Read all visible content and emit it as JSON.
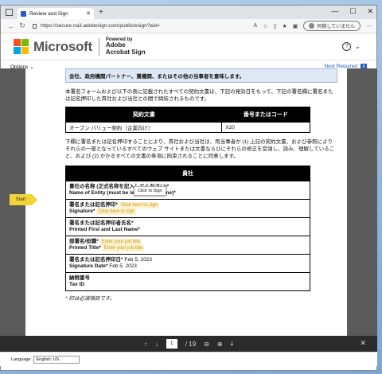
{
  "browser": {
    "tab_title": "Review and Sign",
    "url": "https://secure.na3.adobesign.com/public/esign?aid=",
    "not_synced": "同期していません"
  },
  "brand": {
    "company": "Microsoft",
    "powered_by": "Powered by",
    "product": "Adobe\nAcrobat Sign"
  },
  "toolbar": {
    "options": "Options",
    "next_required": "Next Required",
    "next_count": "8"
  },
  "document": {
    "highlight_text": "会社、政府機関パートナー、賃機関、またはその他の当事者を意味します。",
    "intro": "本署名フォームおよび以下の表に記載されたすべての契約文書は、下記の発効日をもって、下記の署名欄に署名または記名押印した貴社および当社との間で締結されるものです。",
    "contract_table": {
      "headers": [
        "契約文書",
        "番号またはコード"
      ],
      "rows": [
        [
          "オープン バリュー契約（企業向け）",
          "X20"
        ]
      ]
    },
    "agreement_para": "下欄に署名または記名押印することにより、貴社および当社は、両当事者が (1) 上記の契約文書、および参照によりそれらの一部となっているすべてのウェブ サイトまたは文書ならびにそれらの修正を受領し、読み、理解していること、および (2) かかるすべての文書の条項に拘束されることに同意します。",
    "party_header": "貴社",
    "fields": {
      "entity_jp": "貴社の名称 (正式名称を記入してください)*",
      "entity_en": "Name of Entity (must be legal entity name)*",
      "sig_jp": "署名または記名押印*",
      "sig_en": "Signature*",
      "sig_placeholder": "Click here to sign",
      "name_jp": "署名または記名押印者氏名*",
      "name_en": "Printed First and Last Name*",
      "title_jp": "部署名/役職*",
      "title_en": "Printed Title*",
      "title_placeholder": "Enter your job title",
      "date_jp": "署名または記名押印日*",
      "date_en": "Signature Date*",
      "date_value": "Feb 5, 2023",
      "tax_jp": "納税番号",
      "tax_en": "Tax ID"
    },
    "footnote": "* 印は必須項目です。",
    "start_label": "Start",
    "tooltip": "Click to Sign"
  },
  "pager": {
    "current": "1",
    "total": "/ 19"
  },
  "language": {
    "label": "Language",
    "value": "English: US"
  }
}
